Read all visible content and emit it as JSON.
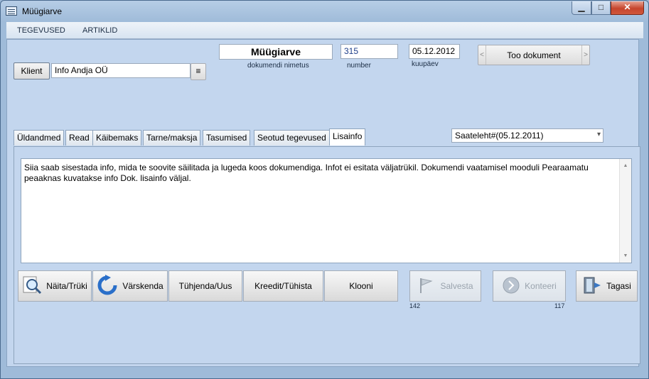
{
  "window": {
    "title": "Müügiarve",
    "minimize_glyph": "▁",
    "maximize_glyph": "□",
    "close_glyph": "✕"
  },
  "menu": {
    "items": [
      "TEGEVUSED",
      "ARTIKLID"
    ]
  },
  "header": {
    "doc_name_value": "Müügiarve",
    "doc_name_caption": "dokumendi nimetus",
    "number_value": "315",
    "number_caption": "number",
    "date_value": "05.12.2012",
    "date_caption": "kuupäev",
    "fetch_document_label": "Too dokument",
    "prev_glyph": "<",
    "next_glyph": ">"
  },
  "client": {
    "button_label": "Klient",
    "value": "Info Andja OÜ",
    "lookup_glyph": "≡"
  },
  "tabs": [
    "Üldandmed",
    "Read",
    "Käibemaks",
    "Tarne/maksja",
    "Tasumised",
    "Seotud tegevused",
    "Lisainfo"
  ],
  "active_tab": "Lisainfo",
  "linked_select": {
    "value": "Saateleht#(05.12.2011)",
    "arrow_glyph": "▾"
  },
  "lisainfo_text": "Siia saab sisestada info, mida te soovite säilitada ja lugeda koos dokumendiga. Infot ei esitata väljatrükil. Dokumendi vaatamisel mooduli Pearaamatu peaaknas kuvatakse info Dok. lisainfo väljal.",
  "scroll": {
    "up_glyph": "▲",
    "down_glyph": "▼"
  },
  "toolbar": {
    "preview_print": "Näita/Trüki",
    "refresh": "Värskenda",
    "clear_new": "Tühjenda/Uus",
    "credit_cancel": "Kreedit/Tühista",
    "clone": "Klooni",
    "save": "Salvesta",
    "post": "Konteeri",
    "back": "Tagasi"
  },
  "counters": {
    "save_count": "142",
    "post_count": "117"
  },
  "icons": {
    "app": "app-window-icon",
    "preview": "magnifier-icon",
    "refresh": "refresh-arrow-icon",
    "save": "flag-icon",
    "post": "ledger-globe-icon",
    "back": "exit-door-icon"
  }
}
